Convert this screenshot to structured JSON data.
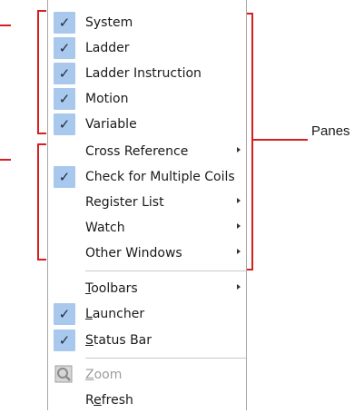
{
  "menu": {
    "items": [
      {
        "label": "System",
        "checked": true
      },
      {
        "label": "Ladder",
        "checked": true
      },
      {
        "label": "Ladder Instruction",
        "checked": true
      },
      {
        "label": "Motion",
        "checked": true
      },
      {
        "label": "Variable",
        "checked": true
      },
      {
        "label": "Cross Reference",
        "checked": false,
        "submenu": true
      },
      {
        "label": "Check for Multiple Coils",
        "checked": true
      },
      {
        "label": "Register List",
        "checked": false,
        "submenu": true
      },
      {
        "label": "Watch",
        "checked": false,
        "submenu": true
      },
      {
        "label": "Other Windows",
        "checked": false,
        "submenu": true
      },
      {
        "label": "Toolbars",
        "checked": false,
        "submenu": true,
        "accesskey": "T"
      },
      {
        "label": "Launcher",
        "checked": true,
        "accesskey": "L"
      },
      {
        "label": "Status Bar",
        "checked": true,
        "accesskey": "S"
      },
      {
        "label": "Zoom",
        "disabled": true,
        "icon": "zoom-icon",
        "accesskey": "Z"
      },
      {
        "label": "Refresh",
        "checked": false,
        "accesskey": "e"
      }
    ]
  },
  "annotation": {
    "panes_label": "Panes",
    "color": "#d81f1f"
  },
  "colors": {
    "check_bg": "#a9c8ee",
    "disabled_text": "#9d9d9d"
  }
}
